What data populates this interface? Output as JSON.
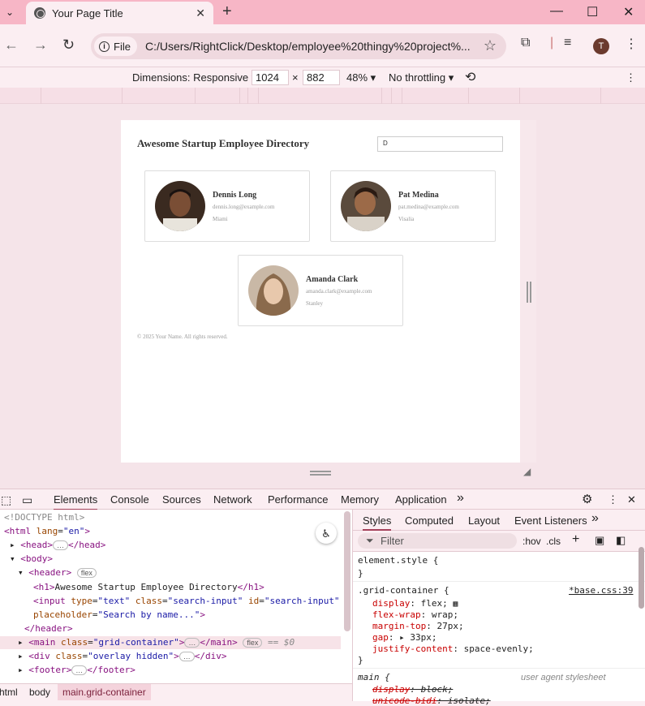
{
  "browser": {
    "tab_title": "Your Page Title",
    "file_chip": "File",
    "url": "C:/Users/RightClick/Desktop/employee%20thingy%20project%..."
  },
  "device_toolbar": {
    "dimensions_label": "Dimensions: Responsive",
    "width": "1024",
    "times": "×",
    "height": "882",
    "zoom": "48%",
    "throttling": "No throttling"
  },
  "page": {
    "title": "Awesome Startup Employee Directory",
    "search_value": "D",
    "employees": [
      {
        "name": "Dennis Long",
        "email": "dennis.long@example.com",
        "city": "Miami"
      },
      {
        "name": "Pat Medina",
        "email": "pat.medina@example.com",
        "city": "Visalia"
      },
      {
        "name": "Amanda Clark",
        "email": "amanda.clark@example.com",
        "city": "Stanley"
      }
    ],
    "footer": "© 2025 Your Name. All rights reserved."
  },
  "devtools": {
    "tabs": [
      "Elements",
      "Console",
      "Sources",
      "Network",
      "Performance",
      "Memory",
      "Application"
    ],
    "more": "»",
    "breadcrumbs": [
      "html",
      "body",
      "main.grid-container"
    ],
    "styles_tabs": [
      "Styles",
      "Computed",
      "Layout",
      "Event Listeners"
    ],
    "filter_placeholder": "Filter",
    "hov": ":hov",
    "cls": ".cls"
  }
}
